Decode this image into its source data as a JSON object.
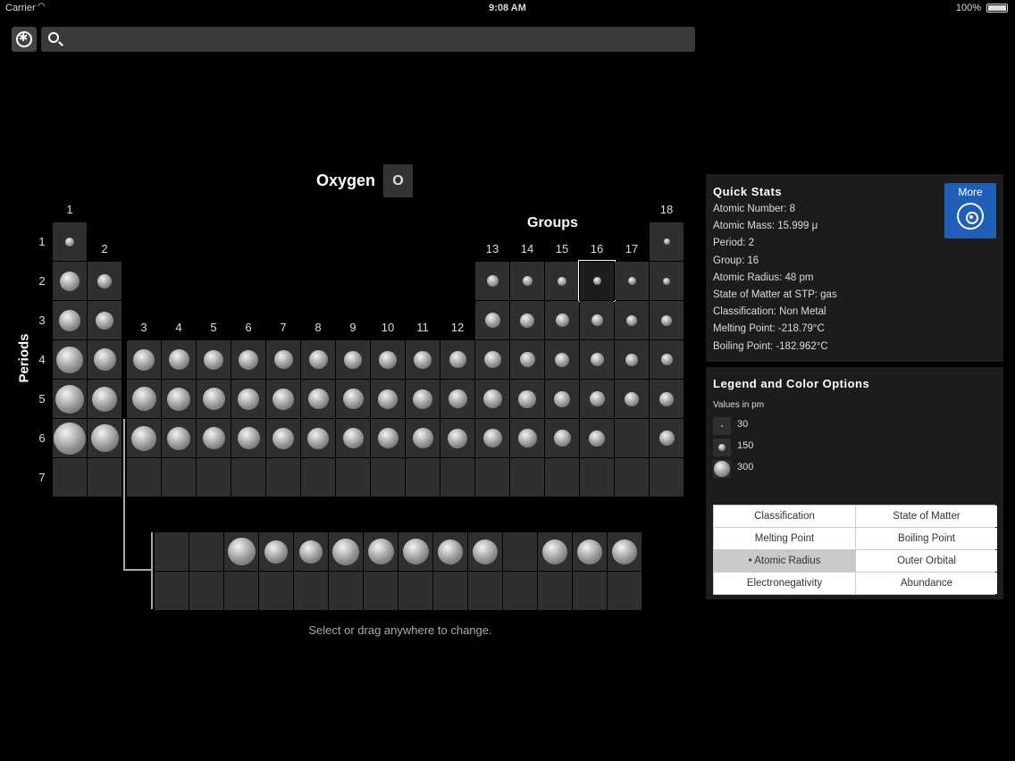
{
  "status_bar": {
    "carrier": "Carrier",
    "time": "9:08 AM",
    "battery": "100%"
  },
  "search": {
    "placeholder": ""
  },
  "element": {
    "name": "Oxygen",
    "symbol": "O"
  },
  "table": {
    "groups_title": "Groups",
    "periods_title": "Periods",
    "group_labels": [
      "1",
      "2",
      "3",
      "4",
      "5",
      "6",
      "7",
      "8",
      "9",
      "10",
      "11",
      "12",
      "13",
      "14",
      "15",
      "16",
      "17",
      "18"
    ],
    "period_labels": [
      "1",
      "2",
      "3",
      "4",
      "5",
      "6",
      "7"
    ],
    "hint": "Select or drag anywhere to change."
  },
  "quick_stats": {
    "title": "Quick Stats",
    "more_label": "More",
    "lines": [
      "Atomic Number: 8",
      "Atomic Mass: 15.999 μ",
      "Period: 2",
      "Group: 16",
      "Atomic Radius: 48 pm",
      "State of Matter at STP: gas",
      "Classification: Non Metal",
      "Melting Point: -218.79°C",
      "Boiling Point: -182.962°C"
    ]
  },
  "legend": {
    "title": "Legend and Color Options",
    "units": "Values in pm",
    "values": [
      "30",
      "150",
      "300"
    ],
    "options": [
      {
        "label": "Classification",
        "active": false
      },
      {
        "label": "State of Matter",
        "active": false
      },
      {
        "label": "Melting Point",
        "active": false
      },
      {
        "label": "Boiling Point",
        "active": false
      },
      {
        "label": "• Atomic Radius",
        "active": true
      },
      {
        "label": "Outer Orbital",
        "active": false
      },
      {
        "label": "Electronegativity",
        "active": false
      },
      {
        "label": "Abundance",
        "active": false
      }
    ]
  },
  "icons": [
    "settings-icon",
    "search-icon",
    "wifi-icon",
    "battery-icon",
    "atom-icon"
  ],
  "atomic_radius_pm": {
    "row1": {
      "1": 53,
      "18": 31
    },
    "row2": {
      "1": 167,
      "2": 112,
      "13": 87,
      "14": 67,
      "15": 56,
      "16": 48,
      "17": 42,
      "18": 38
    },
    "row3": {
      "1": 190,
      "2": 145,
      "13": 118,
      "14": 111,
      "15": 98,
      "16": 88,
      "17": 79,
      "18": 71
    },
    "row4": {
      "1": 243,
      "2": 194,
      "3": 184,
      "4": 176,
      "5": 171,
      "6": 166,
      "7": 161,
      "8": 156,
      "9": 152,
      "10": 149,
      "11": 145,
      "12": 142,
      "13": 136,
      "14": 125,
      "15": 114,
      "16": 103,
      "17": 94,
      "18": 88
    },
    "row5": {
      "1": 265,
      "2": 219,
      "3": 212,
      "4": 206,
      "5": 198,
      "6": 190,
      "7": 183,
      "8": 178,
      "9": 173,
      "10": 169,
      "11": 165,
      "12": 161,
      "13": 156,
      "14": 145,
      "15": 133,
      "16": 123,
      "17": 115,
      "18": 108
    },
    "row6": {
      "1": 298,
      "2": 253,
      "3": 226,
      "4": 208,
      "5": 200,
      "6": 193,
      "7": 188,
      "8": 185,
      "9": 180,
      "10": 177,
      "11": 174,
      "12": 171,
      "13": 156,
      "14": 154,
      "15": 143,
      "16": 135,
      "18": 120
    },
    "lanthanides": [
      0,
      0,
      247,
      206,
      205,
      238,
      231,
      233,
      225,
      228,
      0,
      226,
      222,
      222
    ]
  }
}
